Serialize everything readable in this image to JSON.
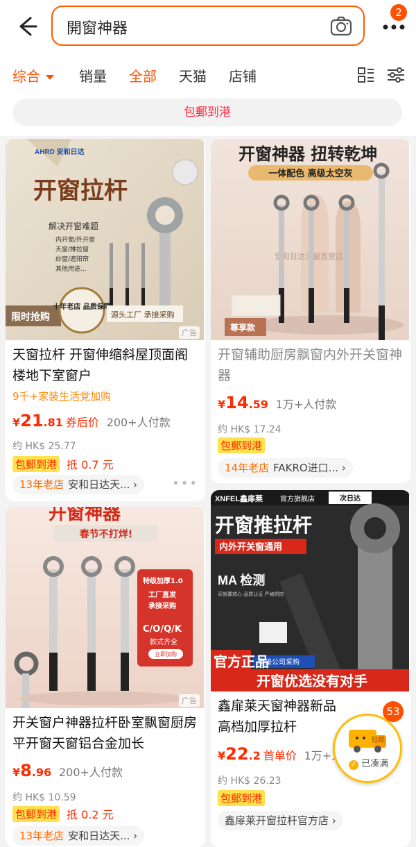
{
  "header": {
    "search_query": "開窗神器",
    "more_badge": "2"
  },
  "filters": {
    "tabs": [
      {
        "label": "综合",
        "active": true,
        "has_dropdown": true
      },
      {
        "label": "销量",
        "active": false
      },
      {
        "label": "全部",
        "active": true
      },
      {
        "label": "天猫",
        "active": false
      },
      {
        "label": "店铺",
        "active": false
      }
    ],
    "chip": "包郵到港"
  },
  "products": [
    {
      "title": "天窗拉杆 开窗伸缩斜屋顶面阁楼地下室窗户",
      "subtitle": "9千+家装生活党加购",
      "price_symbol": "¥",
      "price_int": "21",
      "price_dec": ".81",
      "price_label": "券后价",
      "sales": "200+人付款",
      "hk_price": "约 HK$ 25.77",
      "badge": "包郵到港",
      "coupon": "抵 0.7 元",
      "shop_age": "13年老店",
      "shop_name": "安和日达天...",
      "ad": "广告",
      "image_texts": {
        "brand": "AHRD 安和日达",
        "headline": "开窗拉杆",
        "sticker": "十年老店 品质保障",
        "corner": "限时抢购",
        "foot": "源头工厂 承接采购",
        "line1": "解决开窗难题",
        "line2": "内开窗/外开窗",
        "line3": "天窗/推拉窗",
        "line4": "纱窗/遮阳帘",
        "line5": "其他用途..."
      }
    },
    {
      "title": "开窗辅助厨房飘窗内外开关窗神器",
      "price_symbol": "¥",
      "price_int": "14",
      "price_dec": ".59",
      "sales": "1万+人付款",
      "hk_price": "约 HK$ 17.24",
      "badge": "包郵到港",
      "shop_age": "14年老店",
      "shop_name": "FAKRO进口...",
      "image_texts": {
        "headline": "开窗神器 扭转乾坤",
        "ribbon": "一体配色 高级太空灰",
        "watermark": "安和日达天窗直营店",
        "corner": "尊享款"
      }
    },
    {
      "title": "开关窗户神器拉杆卧室飘窗厨房平开窗天窗铝合金加长",
      "price_symbol": "¥",
      "price_int": "8",
      "price_dec": ".96",
      "sales": "200+人付款",
      "hk_price": "约 HK$ 10.59",
      "badge": "包郵到港",
      "coupon": "抵 0.2 元",
      "shop_age": "13年老店",
      "shop_name": "安和日达天...",
      "ad": "广告",
      "image_texts": {
        "headline": "开窗神器",
        "banner": "春节不打烊!",
        "panel1": "特级加厚1.0",
        "panel2": "工厂直发",
        "panel3": "承接采购",
        "panel4": "C/O/Q/K",
        "panel5": "款式齐全",
        "panel6": "立即加购"
      }
    },
    {
      "title": "鑫扉莱天窗神器新品高档加厚拉杆",
      "price_symbol": "¥",
      "price_int": "22",
      "price_dec": ".2",
      "price_label": "首单价",
      "sales": "1万+人付款",
      "hk_price": "约 HK$ 26.23",
      "badge": "包郵到港",
      "shop_name": "鑫扉莱开窗拉杆官方店",
      "image_texts": {
        "brand": "XNFEL鑫扉莱",
        "store": "官方旗舰店",
        "headline": "开窗推拉杆",
        "subline": "内外开关窗通用",
        "cert": "MA 检测",
        "cert_note": "买就要放心 品质认证 严格把控",
        "left_badge": "官方正品",
        "purchase": "承接公司采购",
        "bottom": "开窗优选没有对手",
        "partner": "次日达"
      }
    }
  ],
  "floating_cart": {
    "badge": "53",
    "truck_text": "包邮",
    "label": "已凑满"
  },
  "colors": {
    "accent": "#ff5000",
    "price_red": "#ff2a00",
    "chip_text": "#ff2a45",
    "badge_yellow": "#ffe14d"
  }
}
